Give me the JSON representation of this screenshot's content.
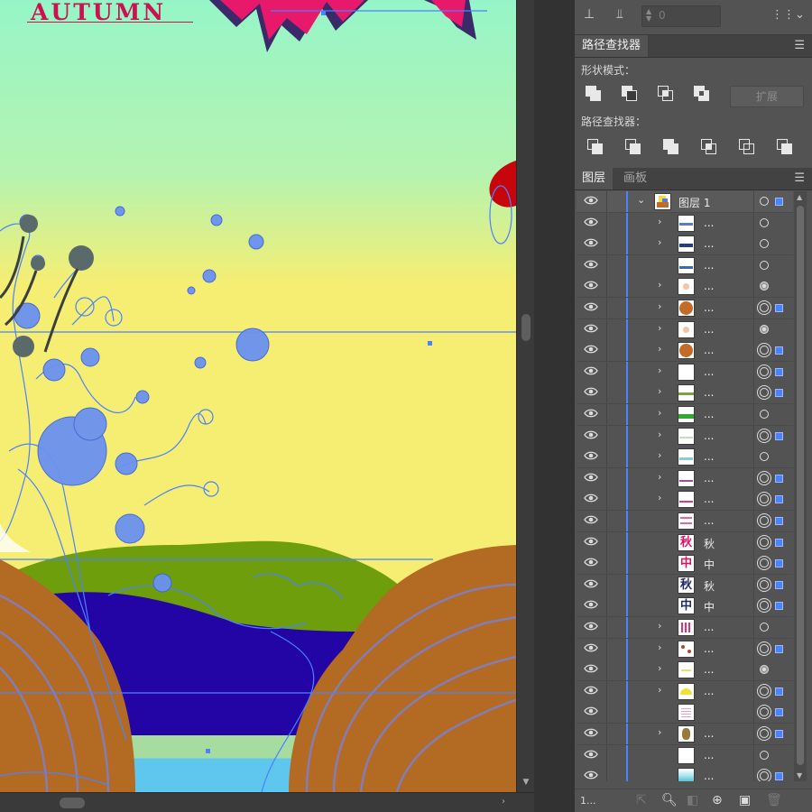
{
  "canvas": {
    "artwork_title": "AUTUMN",
    "colors": {
      "sky_top": "#96f5c8",
      "sky_bottom": "#f6ee72",
      "hill_green": "#6f9e0c",
      "water_blue": "#2305a6",
      "ground_brown": "#b36a22",
      "selection_blue": "#4a82ff",
      "accent_pink": "#c9124f"
    }
  },
  "align_panel": {
    "spacing_value": "0"
  },
  "pathfinder_panel": {
    "tab_label": "路径查找器",
    "shape_modes_label": "形状模式：",
    "expand_label": "扩展",
    "pathfinders_label": "路径查找器："
  },
  "layers_panel": {
    "tabs": [
      "图层",
      "画板"
    ],
    "top_layer": {
      "name": "图层 1",
      "thumb": "mixed"
    },
    "sublayers": [
      {
        "name": "...",
        "expandable": true,
        "thumb": "wave-blue",
        "target": "hollow",
        "selected": false
      },
      {
        "name": "...",
        "expandable": true,
        "thumb": "wave-navy",
        "target": "hollow",
        "selected": false
      },
      {
        "name": "...",
        "expandable": false,
        "thumb": "wave-blue2",
        "target": "hollow",
        "selected": false
      },
      {
        "name": "...",
        "expandable": true,
        "thumb": "dot-peach",
        "target": "filled",
        "selected": false
      },
      {
        "name": "...",
        "expandable": true,
        "thumb": "circle-orange",
        "target": "ring",
        "selected": true
      },
      {
        "name": "...",
        "expandable": true,
        "thumb": "dot-peach",
        "target": "filled",
        "selected": false
      },
      {
        "name": "...",
        "expandable": true,
        "thumb": "circle-orange",
        "target": "ring",
        "selected": true
      },
      {
        "name": "...",
        "expandable": true,
        "thumb": "blank",
        "target": "ring",
        "selected": true
      },
      {
        "name": "...",
        "expandable": true,
        "thumb": "stripe-green",
        "target": "ring",
        "selected": true
      },
      {
        "name": "...",
        "expandable": true,
        "thumb": "stripe-green2",
        "target": "hollow",
        "selected": false
      },
      {
        "name": "...",
        "expandable": true,
        "thumb": "stripe-pale",
        "target": "ring",
        "selected": true
      },
      {
        "name": "...",
        "expandable": true,
        "thumb": "stripe-sky",
        "target": "hollow",
        "selected": false
      },
      {
        "name": "...",
        "expandable": true,
        "thumb": "stripe-purple",
        "target": "ring",
        "selected": true
      },
      {
        "name": "...",
        "expandable": true,
        "thumb": "stripe-pink",
        "target": "ring",
        "selected": true
      },
      {
        "name": "...",
        "expandable": false,
        "thumb": "dots-pink",
        "target": "ring",
        "selected": true
      },
      {
        "name": "秋",
        "expandable": false,
        "thumb": "char-pink-qiu",
        "target": "ring",
        "selected": true
      },
      {
        "name": "中",
        "expandable": false,
        "thumb": "char-pink-zhong",
        "target": "ring",
        "selected": true
      },
      {
        "name": "秋",
        "expandable": false,
        "thumb": "char-navy-qiu",
        "target": "ring",
        "selected": true
      },
      {
        "name": "中",
        "expandable": false,
        "thumb": "char-navy-zhong",
        "target": "ring",
        "selected": true
      },
      {
        "name": "...",
        "expandable": true,
        "thumb": "pattern-pink",
        "target": "hollow",
        "selected": false
      },
      {
        "name": "...",
        "expandable": true,
        "thumb": "flowers",
        "target": "ring",
        "selected": true
      },
      {
        "name": "...",
        "expandable": true,
        "thumb": "dots-yellow",
        "target": "filled",
        "selected": false
      },
      {
        "name": "...",
        "expandable": true,
        "thumb": "half-yellow",
        "target": "ring",
        "selected": true
      },
      {
        "name": "",
        "expandable": false,
        "thumb": "dots-pink2",
        "target": "ring",
        "selected": true
      },
      {
        "name": "...",
        "expandable": true,
        "thumb": "plant",
        "target": "ring",
        "selected": true
      },
      {
        "name": "...",
        "expandable": false,
        "thumb": "blank2",
        "target": "hollow",
        "selected": false
      },
      {
        "name": "...",
        "expandable": false,
        "thumb": "gradient",
        "target": "ring",
        "selected": true
      }
    ],
    "footer_count": "1..."
  }
}
